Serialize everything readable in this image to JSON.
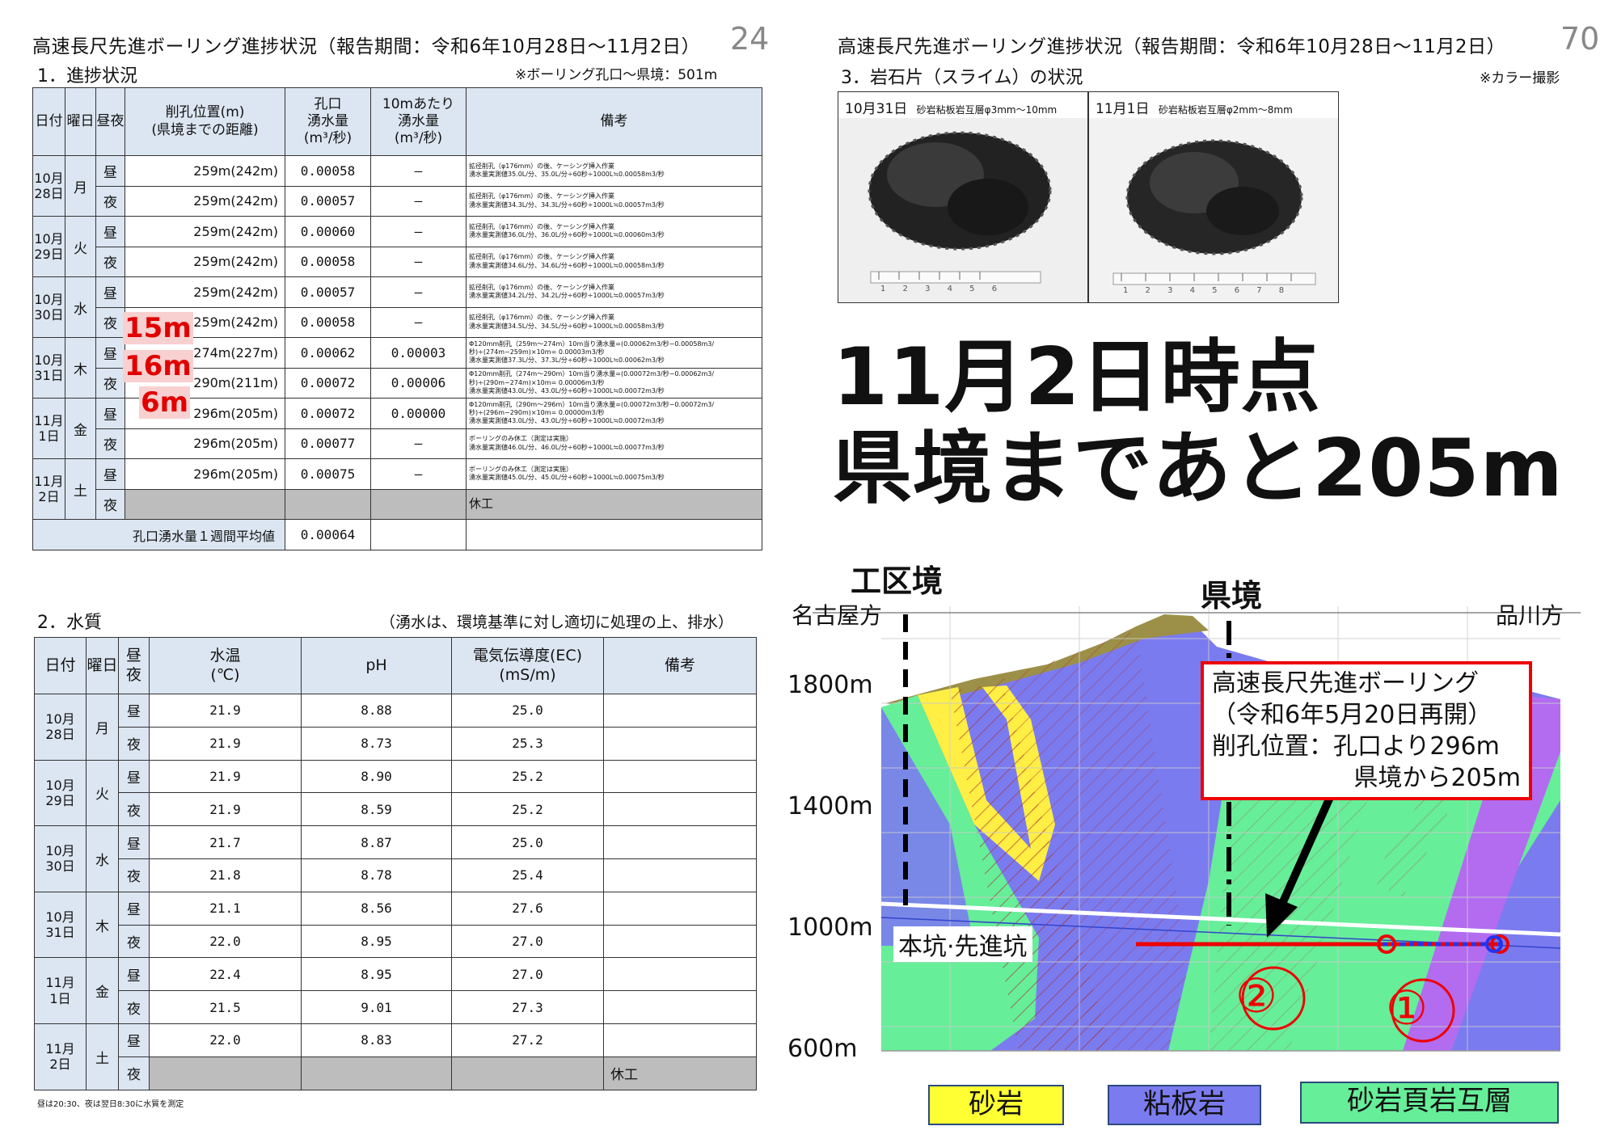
{
  "left": {
    "title": "高速長尺先進ボーリング進捗状況（報告期間：令和6年10月28日〜11月2日）",
    "page_number": "24",
    "section1": "1．進捗状況",
    "section1_note": "※ボーリング孔口〜県境：501m",
    "progress_headers": [
      "日付",
      "曜日",
      "昼夜",
      "削孔位置(m)\n(県境までの距離)",
      "孔口\n湧水量\n(m³/秒)",
      "10mあたり\n湧水量\n(m³/秒)",
      "備考"
    ],
    "progress_days": [
      {
        "date": "10月\n28日",
        "dow": "月",
        "rows": [
          {
            "shift": "昼",
            "pos": "259m(242m)",
            "flow": "0.00058",
            "per10": "―",
            "remark": "拡径削孔（φ176mm）の後、ケーシング挿入作業\n湧水量実測値35.0L/分、35.0L/分÷60秒÷1000L≒0.00058m3/秒"
          },
          {
            "shift": "夜",
            "pos": "259m(242m)",
            "flow": "0.00057",
            "per10": "―",
            "remark": "拡径削孔（φ176mm）の後、ケーシング挿入作業\n湧水量実測値34.3L/分、34.3L/分÷60秒÷1000L≒0.00057m3/秒"
          }
        ]
      },
      {
        "date": "10月\n29日",
        "dow": "火",
        "rows": [
          {
            "shift": "昼",
            "pos": "259m(242m)",
            "flow": "0.00060",
            "per10": "―",
            "remark": "拡径削孔（φ176mm）の後、ケーシング挿入作業\n湧水量実測値36.0L/分、36.0L/分÷60秒÷1000L≒0.00060m3/秒"
          },
          {
            "shift": "夜",
            "pos": "259m(242m)",
            "flow": "0.00058",
            "per10": "―",
            "remark": "拡径削孔（φ176mm）の後、ケーシング挿入作業\n湧水量実測値34.6L/分、34.6L/分÷60秒÷1000L≒0.00058m3/秒"
          }
        ]
      },
      {
        "date": "10月\n30日",
        "dow": "水",
        "rows": [
          {
            "shift": "昼",
            "pos": "259m(242m)",
            "flow": "0.00057",
            "per10": "―",
            "remark": "拡径削孔（φ176mm）の後、ケーシング挿入作業\n湧水量実測値34.2L/分、34.2L/分÷60秒÷1000L≒0.00057m3/秒"
          },
          {
            "shift": "夜",
            "pos": "259m(242m)",
            "flow": "0.00058",
            "per10": "―",
            "remark": "拡径削孔（φ176mm）の後、ケーシング挿入作業\n湧水量実測値34.5L/分、34.5L/分÷60秒÷1000L≒0.00058m3/秒"
          }
        ]
      },
      {
        "date": "10月\n31日",
        "dow": "木",
        "rows": [
          {
            "shift": "昼",
            "pos": "274m(227m)",
            "flow": "0.00062",
            "per10": "0.00003",
            "remark": "Φ120mm削孔（259m〜274m）10m当り湧水量=(0.00062m3/秒−0.00058m3/\n秒)÷(274m−259m)×10m= 0.00003m3/秒\n湧水量実測値37.3L/分、37.3L/分÷60秒÷1000L≒0.00062m3/秒"
          },
          {
            "shift": "夜",
            "pos": "290m(211m)",
            "flow": "0.00072",
            "per10": "0.00006",
            "remark": "Φ120mm削孔（274m〜290m）10m当り湧水量=(0.00072m3/秒−0.00062m3/\n秒)÷(290m−274m)×10m= 0.00006m3/秒\n湧水量実測値43.0L/分、43.0L/分÷60秒÷1000L≒0.00072m3/秒"
          }
        ]
      },
      {
        "date": "11月\n1日",
        "dow": "金",
        "rows": [
          {
            "shift": "昼",
            "pos": "296m(205m)",
            "flow": "0.00072",
            "per10": "0.00000",
            "remark": "Φ120mm削孔（290m〜296m）10m当り湧水量=(0.00072m3/秒−0.00072m3/\n秒)÷(296m−290m)×10m= 0.00000m3/秒\n湧水量実測値43.0L/分、43.0L/分÷60秒÷1000L≒0.00072m3/秒"
          },
          {
            "shift": "夜",
            "pos": "296m(205m)",
            "flow": "0.00077",
            "per10": "―",
            "remark": "ボーリングのみ休工（測定は実施）\n湧水量実測値46.0L/分、46.0L/分÷60秒÷1000L≒0.00077m3/秒"
          }
        ]
      },
      {
        "date": "11月\n2日",
        "dow": "土",
        "rows": [
          {
            "shift": "昼",
            "pos": "296m(205m)",
            "flow": "0.00075",
            "per10": "―",
            "remark": "ボーリングのみ休工（測定は実施）\n湧水量実測値45.0L/分、45.0L/分÷60秒÷1000L≒0.00075m3/秒"
          },
          {
            "shift": "夜",
            "pos": "",
            "flow": "",
            "per10": "",
            "remark": "休工"
          }
        ]
      }
    ],
    "avg_label": "孔口湧水量１週間平均値",
    "avg_value": "0.00064",
    "increments": [
      "15m",
      "16m",
      "6m"
    ],
    "section2": "2．水質",
    "section2_note": "（湧水は、環境基準に対し適切に処理の上、排水）",
    "water_headers": [
      "日付",
      "曜日",
      "昼夜",
      "水温\n(℃)",
      "pH",
      "電気伝導度(EC)\n(mS/m)",
      "備考"
    ],
    "water_days": [
      {
        "date": "10月\n28日",
        "dow": "月",
        "rows": [
          [
            "昼",
            "21.9",
            "8.88",
            "25.0",
            ""
          ],
          [
            "夜",
            "21.9",
            "8.73",
            "25.3",
            ""
          ]
        ]
      },
      {
        "date": "10月\n29日",
        "dow": "火",
        "rows": [
          [
            "昼",
            "21.9",
            "8.90",
            "25.2",
            ""
          ],
          [
            "夜",
            "21.9",
            "8.59",
            "25.2",
            ""
          ]
        ]
      },
      {
        "date": "10月\n30日",
        "dow": "水",
        "rows": [
          [
            "昼",
            "21.7",
            "8.87",
            "25.0",
            ""
          ],
          [
            "夜",
            "21.8",
            "8.78",
            "25.4",
            ""
          ]
        ]
      },
      {
        "date": "10月\n31日",
        "dow": "木",
        "rows": [
          [
            "昼",
            "21.1",
            "8.56",
            "27.6",
            ""
          ],
          [
            "夜",
            "22.0",
            "8.95",
            "27.0",
            ""
          ]
        ]
      },
      {
        "date": "11月\n1日",
        "dow": "金",
        "rows": [
          [
            "昼",
            "22.4",
            "8.95",
            "27.0",
            ""
          ],
          [
            "夜",
            "21.5",
            "9.01",
            "27.3",
            ""
          ]
        ]
      },
      {
        "date": "11月\n2日",
        "dow": "土",
        "rows": [
          [
            "昼",
            "22.0",
            "8.83",
            "27.2",
            ""
          ],
          [
            "夜",
            "",
            "",
            "",
            "休工"
          ]
        ]
      }
    ],
    "footnote": "昼は20:30、夜は翌日8:30に水質を測定"
  },
  "right": {
    "title": "高速長尺先進ボーリング進捗状況（報告期間：令和6年10月28日〜11月2日）",
    "page_number": "70",
    "section3": "3．岩石片（スライム）の状況",
    "section3_note": "※カラー撮影",
    "photos": [
      {
        "date": "10月31日",
        "desc": "砂岩粘板岩互層φ3mm〜10mm",
        "scale": "1 2 3 4 5 6"
      },
      {
        "date": "11月1日",
        "desc": "砂岩粘板岩互層φ2mm〜8mm",
        "scale": "1 2 3 4 5 6 7 8"
      }
    ],
    "big_line1": "11月2日時点",
    "big_line2": "県境まであと205m"
  },
  "diagram": {
    "label_kuiki": "工区境",
    "label_kenkyo": "県境",
    "label_nagoya": "名古屋方",
    "label_shinagawa": "品川方",
    "elevations": [
      "1800m",
      "1400m",
      "1000m",
      "600m"
    ],
    "tunnel_label": "本坑·先進坑",
    "callout": [
      "高速長尺先進ボーリング",
      "（令和6年5月20日再開）",
      "削孔位置：孔口より296m",
      "県境から205m"
    ],
    "circle_labels": [
      "②",
      "①"
    ],
    "legend": [
      {
        "label": "砂岩",
        "color": "#ffff33"
      },
      {
        "label": "粘板岩",
        "color": "#7b7bf0"
      },
      {
        "label": "砂岩頁岩互層",
        "color": "#66ee99"
      }
    ]
  }
}
